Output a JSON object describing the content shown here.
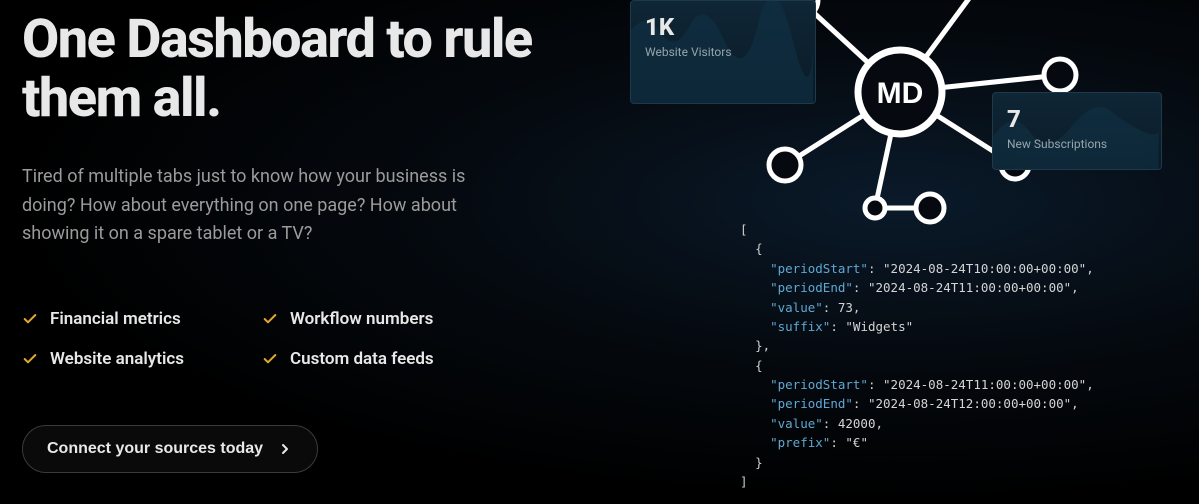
{
  "hero": {
    "headline": "One Dashboard to rule them all.",
    "subtext": "Tired of multiple tabs just to know how your business is doing? How about everything on one page? How about showing it on a spare tablet or a TV?"
  },
  "features": [
    "Financial metrics",
    "Workflow numbers",
    "Website analytics",
    "Custom data feeds"
  ],
  "cta": {
    "label": "Connect your sources today"
  },
  "cards": {
    "visitors": {
      "value": "1K",
      "label": "Website Visitors"
    },
    "subscriptions": {
      "value": "7",
      "label": "New Subscriptions"
    }
  },
  "hub": {
    "center_label": "MD"
  },
  "code": {
    "records": [
      {
        "periodStart": "2024-08-24T10:00:00+00:00",
        "periodEnd": "2024-08-24T11:00:00+00:00",
        "value": 73,
        "suffix": "Widgets"
      },
      {
        "periodStart": "2024-08-24T11:00:00+00:00",
        "periodEnd": "2024-08-24T12:00:00+00:00",
        "value": 42000,
        "prefix": "€"
      }
    ]
  }
}
